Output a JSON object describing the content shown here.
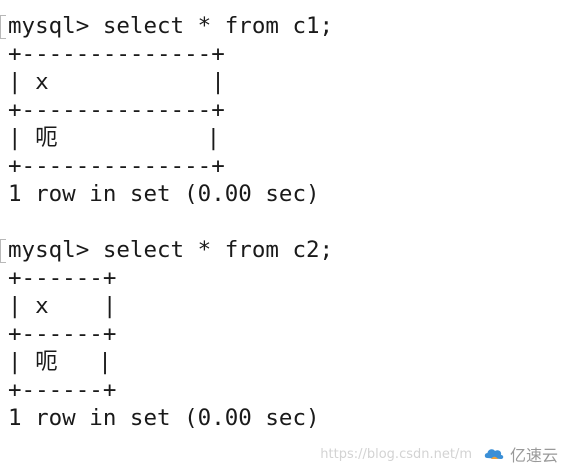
{
  "terminal": {
    "lines": [
      "mysql> select * from c1;",
      "+--------------+",
      "| x            |",
      "+--------------+",
      "| 呃           |",
      "+--------------+",
      "1 row in set (0.00 sec)",
      "mysql> select * from c2;",
      "+------+",
      "| x    |",
      "+------+",
      "| 呃   |",
      "+------+",
      "1 row in set (0.00 sec)"
    ]
  },
  "watermark": {
    "url": "https://blog.csdn.net/m",
    "brand": "亿速云"
  },
  "colors": {
    "text": "#1a1a1a",
    "background": "#ffffff",
    "watermark": "#d3d3d3",
    "brand_text": "#999999",
    "brand_logo_blue": "#3b8fd6",
    "brand_logo_orange": "#f2a33a"
  }
}
